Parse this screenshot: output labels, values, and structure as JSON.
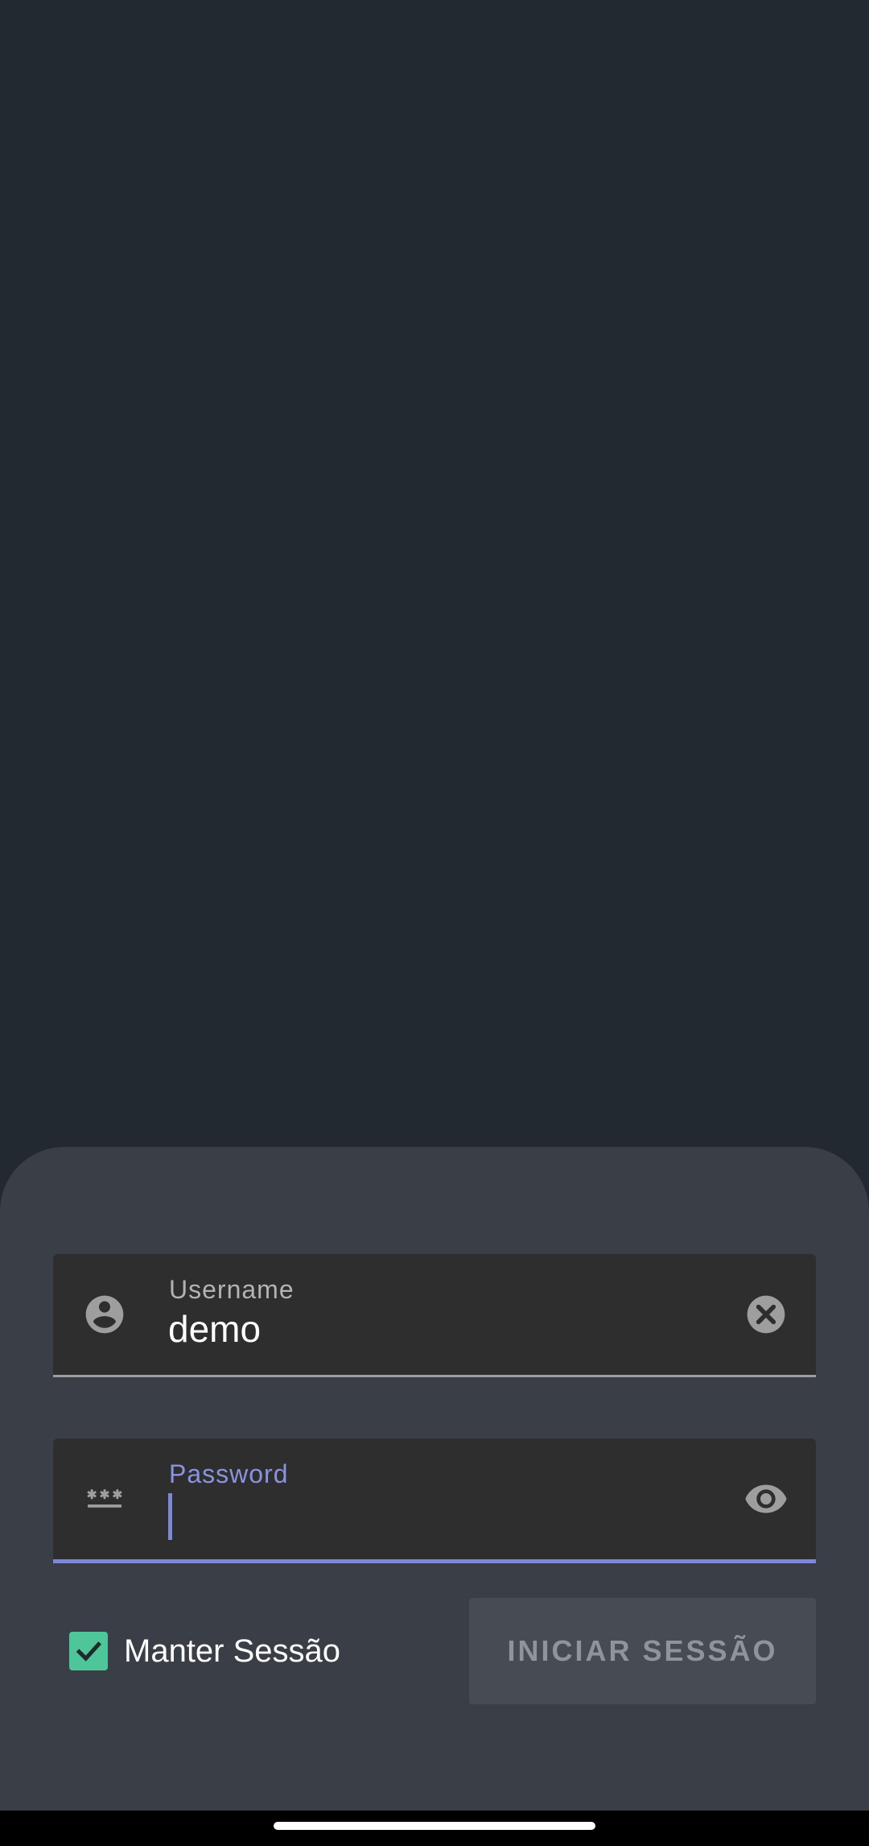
{
  "login_form": {
    "username": {
      "label": "Username",
      "value": "demo",
      "leading_icon": "account-circle-icon",
      "trailing_icon": "clear-icon"
    },
    "password": {
      "label": "Password",
      "value": "",
      "leading_icon": "password-icon",
      "trailing_icon": "visibility-icon",
      "focused": true
    },
    "remember": {
      "label": "Manter Sessão",
      "checked": true
    },
    "submit_label": "INICIAR SESSÃO"
  },
  "colors": {
    "background": "#232931",
    "sheet": "#3a3e47",
    "field": "#2e2e2e",
    "focus_accent": "#7c88d8",
    "checkbox": "#4fc69a",
    "button": "#474b54"
  }
}
